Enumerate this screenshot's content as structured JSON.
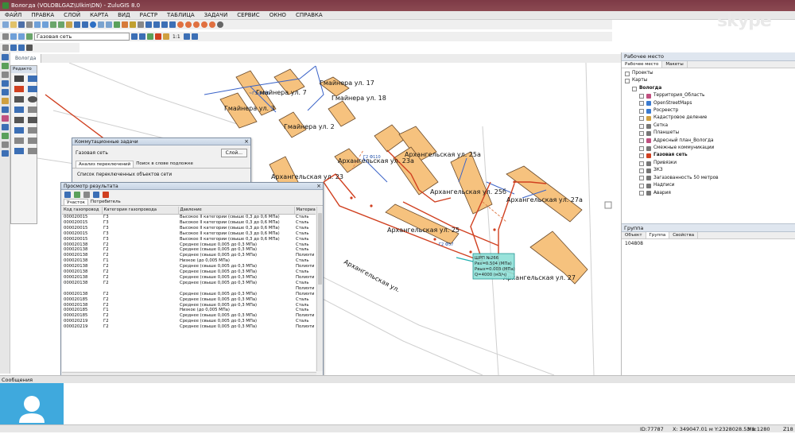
{
  "window": {
    "title": "Вологда (VOLOBLGAZ\\Ulkin\\DN) - ZuluGIS 8.0"
  },
  "menu": [
    "ФАЙЛ",
    "ПРАВКА",
    "СЛОЙ",
    "КАРТА",
    "ВИД",
    "РАСТР",
    "ТАБЛИЦА",
    "ЗАДАЧИ",
    "СЕРВИС",
    "ОКНО",
    "СПРАВКА"
  ],
  "toolbar": {
    "layer_select": "Газовая сеть",
    "zoom_label": "1:1"
  },
  "watermark": "skype",
  "map": {
    "tab_label": "Вологда",
    "palette_title": "Редакто",
    "buildings": [
      "Гмайнера ул. 7",
      "Гмайнера ул. 17",
      "Гмайнера ул. 18",
      "Гмайнера ул. 3",
      "Гмайнера ул. 2",
      "Архангельская ул. 23а",
      "Архангельская ул. 25а",
      "Архангельская ул. 23",
      "Архангельская ул. 25б",
      "Архангельская ул. 27а",
      "Архангельская ул. 25",
      "Архангельская ул. 27"
    ],
    "street_label": "Архангельская ул.",
    "grp_tooltip": [
      "ШРП №266",
      "Рвх=0.504 (МПа)",
      "Рвых=0.003 (МПа)",
      "Q=4000 (м3/ч)"
    ]
  },
  "switching_window": {
    "title": "Коммутационные задачи",
    "network_label": "Газовая сеть",
    "button_label": "Слой...",
    "tabs": [
      "Анализ переключений",
      "Поиск в слове подложке"
    ],
    "list_label": "Список переключенных объектов сети"
  },
  "results_window": {
    "title": "Просмотр результата",
    "tabs": [
      "Участок",
      "Потребитель"
    ],
    "columns": [
      "Код газопровод",
      "Категория газопровода",
      "Давление",
      "Материа"
    ],
    "rows": [
      [
        "000020015",
        "Г3",
        "Высокое II категории (свыше 0,3 до 0,6 МПа)",
        "Сталь"
      ],
      [
        "000020015",
        "Г3",
        "Высокое II категории (свыше 0,3 до 0,6 МПа)",
        "Сталь"
      ],
      [
        "000020015",
        "Г3",
        "Высокое II категории (свыше 0,3 до 0,6 МПа)",
        "Сталь"
      ],
      [
        "000020015",
        "Г3",
        "Высокое II категории (свыше 0,3 до 0,6 МПа)",
        "Сталь"
      ],
      [
        "000020015",
        "Г3",
        "Высокое II категории (свыше 0,3 до 0,6 МПа)",
        "Сталь"
      ],
      [
        "000020138",
        "Г2",
        "Среднее (свыше 0,005 до 0,3 МПа)",
        "Сталь"
      ],
      [
        "000020138",
        "Г2",
        "Среднее (свыше 0,005 до 0,3 МПа)",
        "Сталь"
      ],
      [
        "000020138",
        "Г2",
        "Среднее (свыше 0,005 до 0,3 МПа)",
        "Полиэти"
      ],
      [
        "000020138",
        "Г1",
        "Низкое (до 0,005 МПа)",
        "Сталь"
      ],
      [
        "000020138",
        "Г2",
        "Среднее (свыше 0,005 до 0,3 МПа)",
        "Полиэти"
      ],
      [
        "000020138",
        "Г2",
        "Среднее (свыше 0,005 до 0,3 МПа)",
        "Сталь"
      ],
      [
        "000020138",
        "Г2",
        "Среднее (свыше 0,005 до 0,3 МПа)",
        "Полиэти"
      ],
      [
        "000020138",
        "Г2",
        "Среднее (свыше 0,005 до 0,3 МПа)",
        "Сталь"
      ],
      [
        "",
        "",
        "",
        "Полиэти"
      ],
      [
        "000020138",
        "Г2",
        "Среднее (свыше 0,005 до 0,3 МПа)",
        "Полиэти"
      ],
      [
        "000020185",
        "Г2",
        "Среднее (свыше 0,005 до 0,3 МПа)",
        "Сталь"
      ],
      [
        "000020138",
        "Г2",
        "Среднее (свыше 0,005 до 0,3 МПа)",
        "Сталь"
      ],
      [
        "000020185",
        "Г1",
        "Низкое (до 0,005 МПа)",
        "Сталь"
      ],
      [
        "000020185",
        "Г2",
        "Среднее (свыше 0,005 до 0,3 МПа)",
        "Полиэти"
      ],
      [
        "000020219",
        "Г2",
        "Среднее (свыше 0,005 до 0,3 МПа)",
        "Сталь"
      ],
      [
        "000020219",
        "Г2",
        "Среднее (свыше 0,005 до 0,3 МПа)",
        "Полиэти"
      ]
    ]
  },
  "workspace": {
    "title": "Рабочее место",
    "tabs": [
      "Рабочее место",
      "Макеты"
    ],
    "tree": [
      {
        "label": "Проекты",
        "level": 0
      },
      {
        "label": "Карты",
        "level": 0
      },
      {
        "label": "Вологда",
        "level": 1,
        "bold": true
      },
      {
        "label": "Территория_Область",
        "level": 2,
        "color": "#c05080"
      },
      {
        "label": "OpenStreetMaps",
        "level": 2,
        "color": "#3a7ad0"
      },
      {
        "label": "Росреестр",
        "level": 2,
        "color": "#3a7ad0"
      },
      {
        "label": "Кадастровое деление",
        "level": 2,
        "color": "#d0a040"
      },
      {
        "label": "Сетка",
        "level": 2,
        "color": "#777777"
      },
      {
        "label": "Планшеты",
        "level": 2,
        "color": "#777777"
      },
      {
        "label": "Адресный план_Вологда",
        "level": 2,
        "color": "#c05080"
      },
      {
        "label": "Смежные коммуникации",
        "level": 2,
        "color": "#777777"
      },
      {
        "label": "Газовая сеть",
        "level": 2,
        "color": "#d04020",
        "bold": true
      },
      {
        "label": "Привязки",
        "level": 2,
        "color": "#777777"
      },
      {
        "label": "ЗКЗ",
        "level": 2,
        "color": "#777777"
      },
      {
        "label": "Загазованность 50 метров",
        "level": 2,
        "color": "#777777"
      },
      {
        "label": "Надписи",
        "level": 2,
        "color": "#777777"
      },
      {
        "label": "Авария",
        "level": 2,
        "color": "#777777"
      }
    ]
  },
  "group_panel": {
    "title": "Группа",
    "tabs": [
      "Объект",
      "Группа",
      "Свойства"
    ],
    "value": "104808"
  },
  "message_panel": {
    "title": "Сообщения"
  },
  "status": {
    "id": "ID:77787",
    "coords": "X: 349047.01 м  Y:2328028.53 м",
    "scale": "M1:1280",
    "zoom": "Z18"
  }
}
